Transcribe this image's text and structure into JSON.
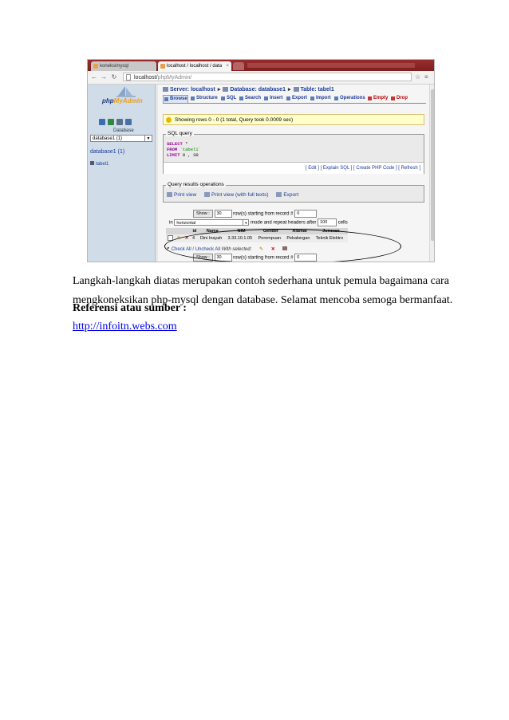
{
  "screenshot": {
    "tabs": [
      {
        "label": "koneksimysql"
      },
      {
        "label": "localhost / localhost / data"
      }
    ],
    "tab_close": "×",
    "address": {
      "host": "localhost/",
      "path": "phpMyAdmin/"
    },
    "left": {
      "logo_part1": "php",
      "logo_part2": "MyAdmin",
      "database_label": "Database",
      "database_select": "database1 (1)",
      "database_name": "database1 (1)",
      "table_name": "tabel1",
      "icon_colors": [
        "#3b6db3",
        "#2e8b3e",
        "#5a6e8e",
        "#4a6fa5"
      ]
    },
    "breadcrumb": {
      "server": "Server: localhost",
      "database": "Database: database1",
      "table": "Table: tabel1",
      "sep": "▸"
    },
    "menu_tabs": [
      {
        "label": "Browse",
        "active": true
      },
      {
        "label": "Structure"
      },
      {
        "label": "SQL"
      },
      {
        "label": "Search"
      },
      {
        "label": "Insert"
      },
      {
        "label": "Export"
      },
      {
        "label": "Import"
      },
      {
        "label": "Operations"
      },
      {
        "label": "Empty",
        "danger": true
      },
      {
        "label": "Drop",
        "danger": true
      }
    ],
    "notice": "Showing rows 0 - 0 (1 total, Query took 0.0009 sec)",
    "sql_query": {
      "legend": "SQL query",
      "select_kw": "SELECT",
      "select_rest": " *",
      "from_kw": "FROM",
      "from_rest": " `tabel1`",
      "limit_kw": "LIMIT",
      "limit_rest": " 0 , 30",
      "links": "[ Edit ] [ Explain SQL ] [ Create PHP Code ] [ Refresh ]"
    },
    "query_ops": {
      "legend": "Query results operations",
      "items": [
        "Print view",
        "Print view (with full texts)",
        "Export"
      ]
    },
    "nav": {
      "show": "Show :",
      "rows_value": "30",
      "rows_text": "row(s) starting from record #",
      "record_value": "0",
      "in": "in",
      "mode_value": "horizontal",
      "mode_text": "mode and repeat headers after",
      "headers_value": "100",
      "cells": "cells"
    },
    "table": {
      "headers": [
        "",
        "",
        "",
        "id",
        "Nama",
        "NIM",
        "Gender",
        "Alamat",
        "Jurusan"
      ],
      "rows": [
        {
          "id": "4",
          "nama": "Dini Inayah",
          "nim": "3.33.10.1.05",
          "gender": "Perempuan",
          "alamat": "Pekalongan",
          "jurusan": "Teknik Elektro"
        }
      ]
    },
    "check_all": {
      "link": "Check All / Uncheck All",
      "with_selected": "With selected:"
    }
  },
  "text": {
    "line1": "Langkah-langkah diatas merupakan contoh sederhana untuk pemula bagaimana cara",
    "line2": "mengkoneksikan php-mysql dengan database. Selamat mencoba semoga bermanfaat.",
    "ref_heading": "Referensi atau sumber :",
    "ref_link": "http://infoitn.webs.com"
  }
}
